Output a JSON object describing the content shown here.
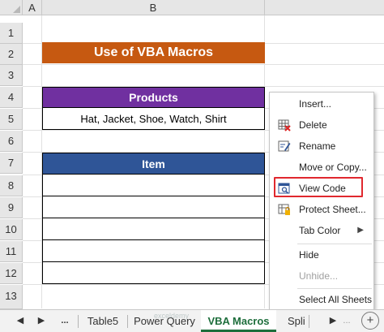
{
  "columns": [
    "A",
    "B"
  ],
  "rows": [
    "1",
    "2",
    "3",
    "4",
    "5",
    "6",
    "7",
    "8",
    "9",
    "10",
    "11",
    "12",
    "13"
  ],
  "sheet": {
    "title": "Use of VBA Macros",
    "products_header": "Products",
    "products_value": "Hat, Jacket, Shoe, Watch, Shirt",
    "item_header": "Item"
  },
  "menu": {
    "insert": "Insert...",
    "delete": "Delete",
    "rename": "Rename",
    "move_copy": "Move or Copy...",
    "view_code": "View Code",
    "protect_sheet": "Protect Sheet...",
    "tab_color": "Tab Color",
    "hide": "Hide",
    "unhide": "Unhide...",
    "select_all": "Select All Sheets",
    "submenu_arrow": "▶"
  },
  "tabs": {
    "prev": "◀",
    "next": "▶",
    "more": "...",
    "items": [
      "Table5",
      "Power Query",
      "VBA Macros",
      "Spli"
    ],
    "add": "+"
  },
  "watermark": "exceldemy",
  "colors": {
    "title_bg": "#c65911",
    "products_bg": "#7030a0",
    "item_bg": "#2f5597",
    "highlight": "#e0282e",
    "active_tab": "#1e6e3c"
  }
}
